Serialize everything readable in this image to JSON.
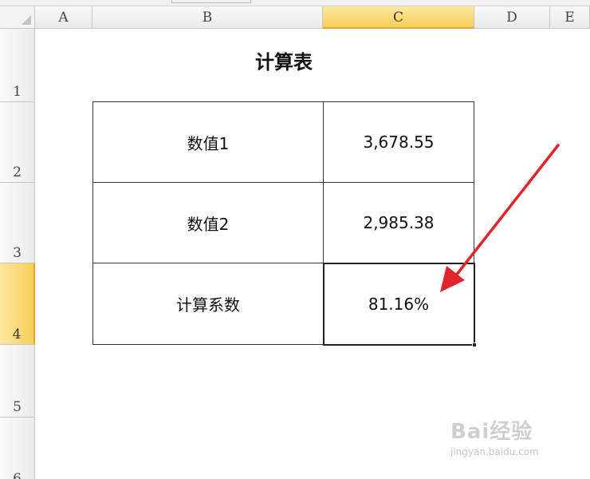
{
  "columns": {
    "A": "A",
    "B": "B",
    "C": "C",
    "D": "D",
    "E": "E"
  },
  "rows": {
    "r1": "1",
    "r2": "2",
    "r3": "3",
    "r4": "4",
    "r5": "5",
    "r6": "6"
  },
  "sheet": {
    "title": "计算表",
    "cells": {
      "b2": "数值1",
      "c2": "3,678.55",
      "b3": "数值2",
      "c3": "2,985.38",
      "b4": "计算系数",
      "c4": "81.16%"
    },
    "active_cell": "C4"
  },
  "annotation": {
    "arrow_color": "#e0242a"
  },
  "watermark": {
    "logo": "Bai经验",
    "url": "jingyan.baidu.com"
  },
  "colors": {
    "header_active": "#f7cf59",
    "grid": "#c6c6c6"
  }
}
